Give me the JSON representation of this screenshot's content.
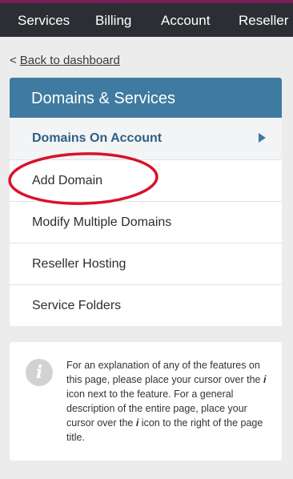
{
  "nav": {
    "items": [
      {
        "label": "Services"
      },
      {
        "label": "Billing"
      },
      {
        "label": "Account"
      },
      {
        "label": "Reseller"
      }
    ]
  },
  "back_link": {
    "prefix": "<",
    "label": "Back to dashboard"
  },
  "panel": {
    "title": "Domains & Services",
    "items": [
      {
        "label": "Domains On Account",
        "active": true
      },
      {
        "label": "Add Domain"
      },
      {
        "label": "Modify Multiple Domains"
      },
      {
        "label": "Reseller Hosting"
      },
      {
        "label": "Service Folders"
      }
    ]
  },
  "info": {
    "icon": "i",
    "text_1": "For an explanation of any of the features on this page, please place your cursor over the ",
    "icon_word_1": "i",
    "text_2": " icon next to the feature. For a general description of the entire page, place your cursor over the ",
    "icon_word_2": "i",
    "text_3": " icon to the right of the page title."
  },
  "colors": {
    "nav_bg": "#2b2f33",
    "accent": "#3f7aa0",
    "active_text": "#2f5f82",
    "annotation": "#d8122a"
  }
}
